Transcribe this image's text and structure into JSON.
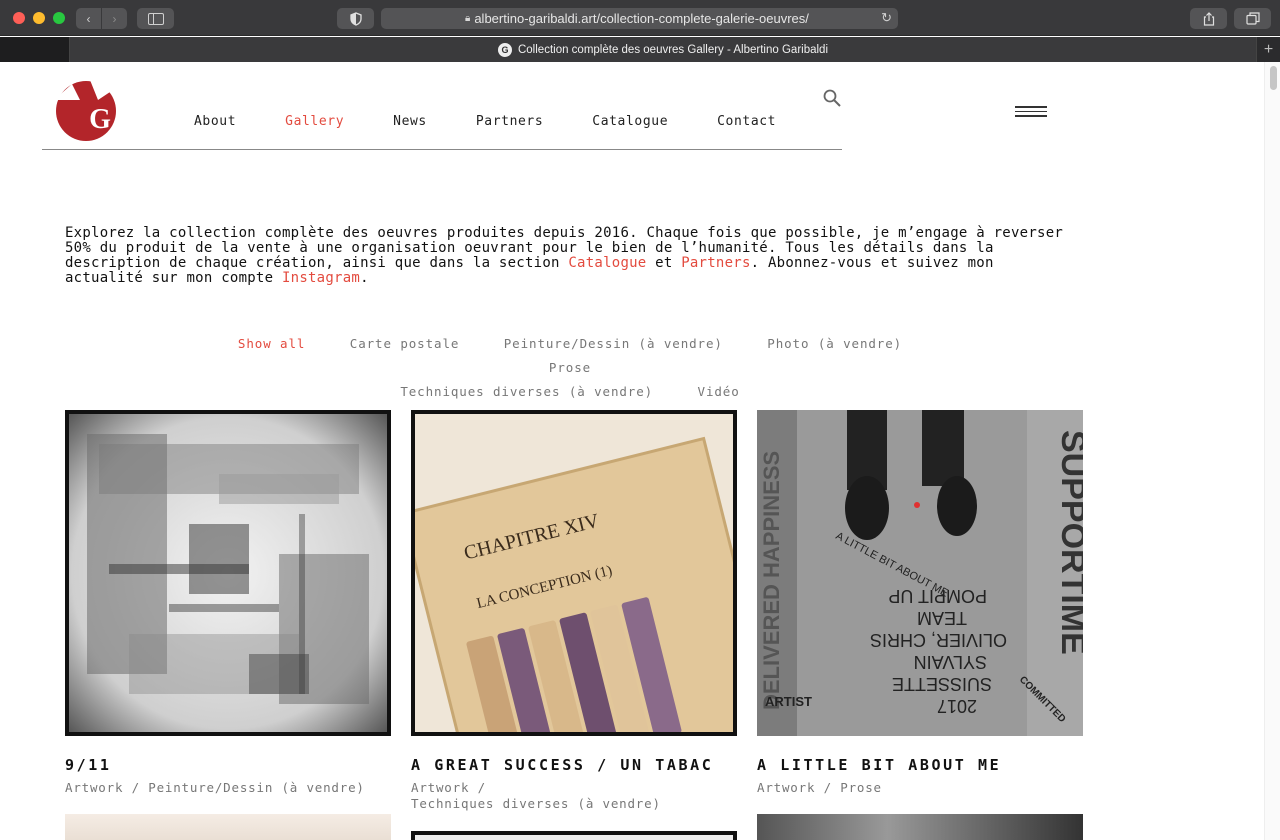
{
  "browser": {
    "url": "albertino-garibaldi.art/collection-complete-galerie-oeuvres/",
    "tab_title": "Collection complète des oeuvres Gallery - Albertino Garibaldi",
    "favicon_letter": "G"
  },
  "site": {
    "brand_color": "#b3252a",
    "accent_color": "#e34b3f",
    "logo_letter": "G",
    "nav": [
      {
        "label": "About"
      },
      {
        "label": "Gallery",
        "active": true
      },
      {
        "label": "News"
      },
      {
        "label": "Partners"
      },
      {
        "label": "Catalogue"
      },
      {
        "label": "Contact"
      }
    ]
  },
  "intro": {
    "text_1": "Explorez la collection complète des oeuvres produites depuis 2016. Chaque fois que possible, je m’engage à reverser 50% du produit de la vente à une organisation oeuvrant pour le bien de l’humanité. Tous les détails dans la description de chaque création, ainsi que dans la section ",
    "link_catalogue": "Catalogue",
    "text_2": " et ",
    "link_partners": "Partners",
    "text_3": ". Abonnez-vous et suivez mon actualité sur mon compte ",
    "link_instagram": "Instagram",
    "text_4": "."
  },
  "filters": [
    {
      "label": "Show all",
      "active": true
    },
    {
      "label": "Carte postale"
    },
    {
      "label": "Peinture/Dessin (à vendre)"
    },
    {
      "label": "Photo (à vendre)"
    },
    {
      "label": "Prose"
    },
    {
      "label": "Techniques diverses (à vendre)"
    },
    {
      "label": "Vidéo"
    }
  ],
  "gallery": [
    {
      "title": "9/11",
      "meta_line1": "Artwork / Peinture/Dessin (à vendre)",
      "meta_line2": ""
    },
    {
      "title": "A GREAT SUCCESS / UN TABAC",
      "meta_line1": "Artwork /",
      "meta_line2": "Techniques diverses (à vendre)",
      "image_text": {
        "chapter": "CHAPITRE XIV",
        "section": "LA CONCEPTION (1)"
      }
    },
    {
      "title": "A LITTLE BIT ABOUT ME",
      "meta_line1": "Artwork / Prose",
      "meta_line2": "",
      "image_text": {
        "brand": "SUPPORTIME",
        "circle": "A LITTLE BIT ABOUT ME",
        "line1": "POMPIT UP",
        "line2": "TEAM",
        "line3": "OLIVIER, CHRIS",
        "line4": "SYLVAIN",
        "line5": "SUISSETTE",
        "line6": "2017",
        "artist": "ARTIST",
        "committed": "COMMITTED",
        "left": "DELIVERED HAPPINESS"
      }
    }
  ]
}
